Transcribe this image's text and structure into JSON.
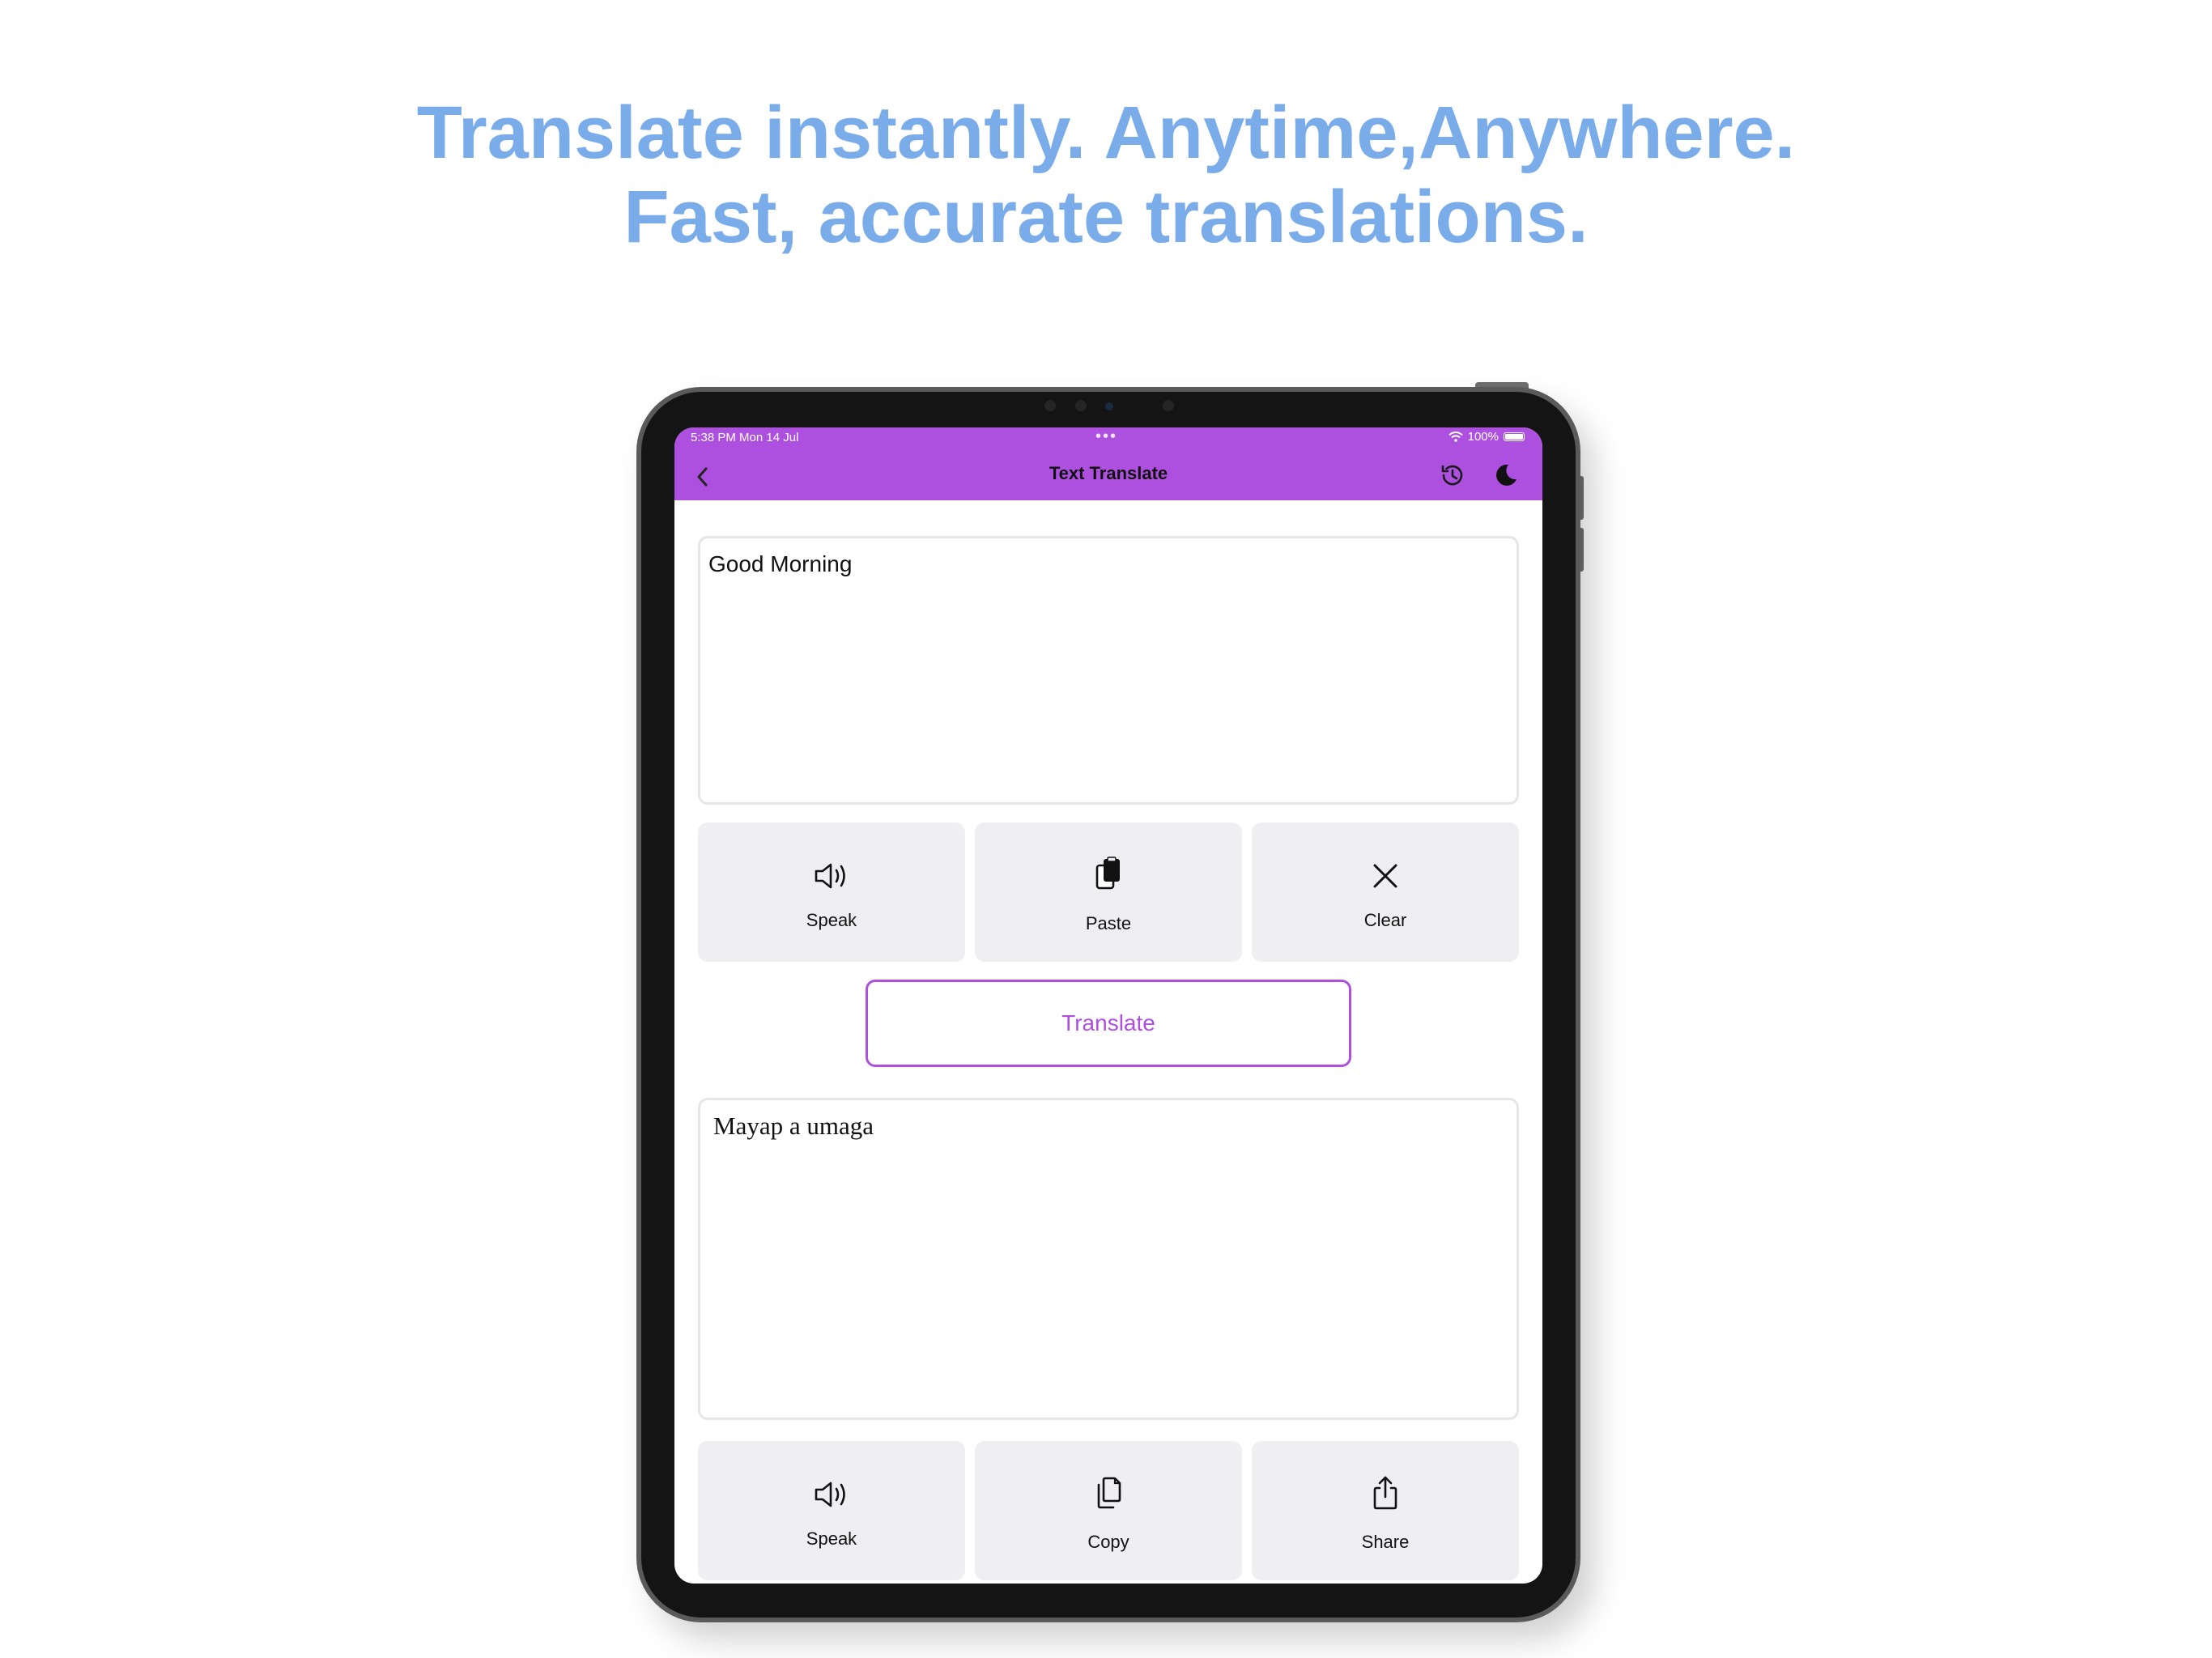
{
  "headline": {
    "line1": "Translate instantly. Anytime,Anywhere.",
    "line2": "Fast, accurate translations."
  },
  "status_bar": {
    "time": "5:38 PM   Mon 14 Jul",
    "battery": "100%"
  },
  "nav": {
    "title": "Text Translate",
    "icons": [
      "back-chevron-icon",
      "history-icon",
      "moon-icon"
    ]
  },
  "colors": {
    "accent": "#ad50df",
    "headline": "#79ace9",
    "button_bg": "#efeff1"
  },
  "input": {
    "text": "Good Morning"
  },
  "input_actions": {
    "speak_label": "Speak",
    "paste_label": "Paste",
    "clear_label": "Clear"
  },
  "translate_label": "Translate",
  "output": {
    "text": "Mayap a umaga"
  },
  "output_actions": {
    "speak_label": "Speak",
    "copy_label": "Copy",
    "share_label": "Share"
  }
}
